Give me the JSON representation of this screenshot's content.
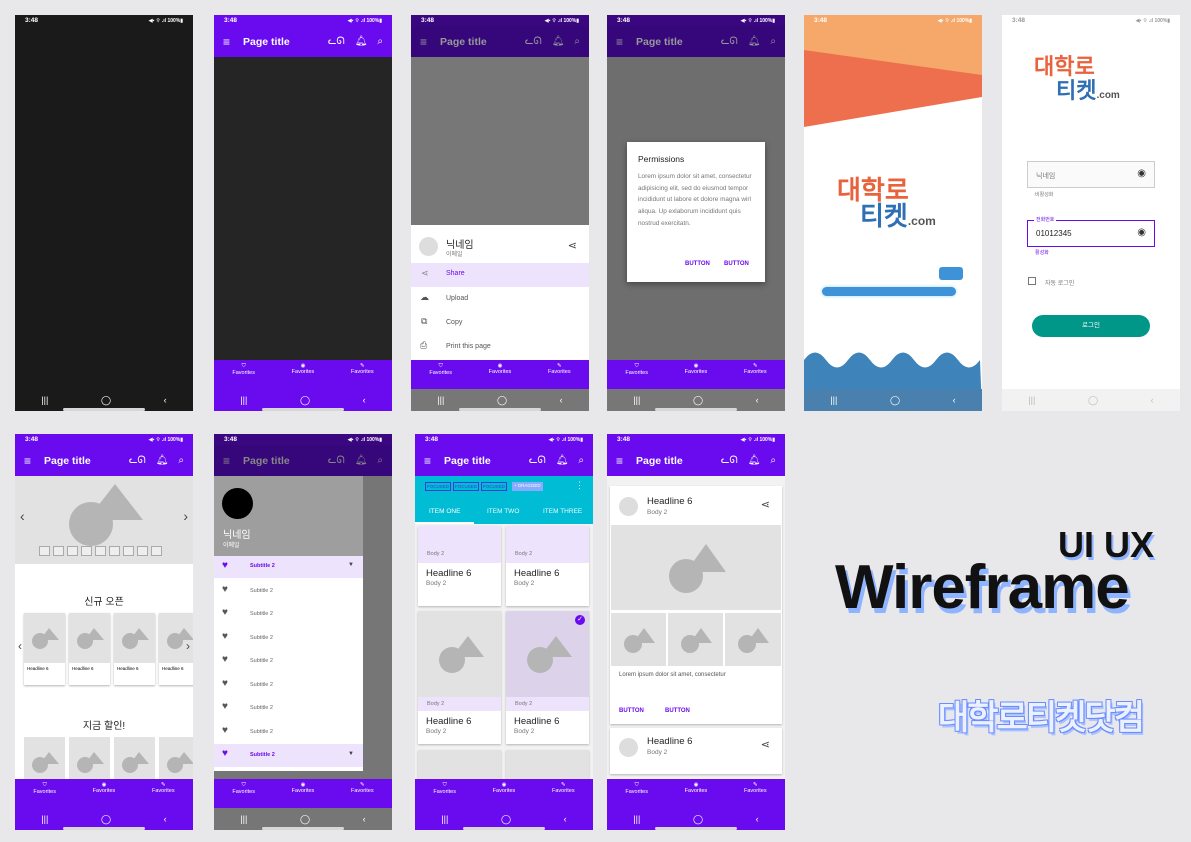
{
  "status": {
    "time": "3:48",
    "icons": "◀▪ ⌔ .ıl 100%▮"
  },
  "appbar": {
    "title": "Page title"
  },
  "bottom_nav": [
    "Favorites",
    "Favorites",
    "Favorites"
  ],
  "sheet": {
    "name": "닉네임",
    "sub": "이메일",
    "items": [
      "Share",
      "Upload",
      "Copy",
      "Print this page"
    ]
  },
  "dialog": {
    "title": "Permissions",
    "body": "Lorem ipsum dolor sit amet, consectetur adipisicing elit, sed do eiusmod tempor incididunt ut labore et dolore magna wirl aliqua. Up exlaborum incididunt quis nostrud exercitatn.",
    "btn1": "BUTTON",
    "btn2": "BUTTON"
  },
  "splash": {
    "logo_line1": "대학로",
    "logo_line2": "티켓",
    "logo_suffix": ".com"
  },
  "login": {
    "field1_value": "닉네임",
    "field1_helper": "비활성화",
    "field2_label": "전화번호",
    "field2_value": "01012345",
    "field2_helper": "활성화",
    "auto_login": "자동 로그인",
    "login_btn": "로그인"
  },
  "main": {
    "section1": "신규 오픈",
    "section2": "지금 할인!",
    "card_title": "Headline 6",
    "card_body": "Body 2"
  },
  "drawer": {
    "name": "닉네임",
    "sub": "이메일",
    "item": "Subtitle 2"
  },
  "grid": {
    "chips": [
      "FOCUSED",
      "FOCUSED",
      "FOCUSED"
    ],
    "drag_chip": "+ DRAGGED",
    "tabs": [
      "ITEM ONE",
      "ITEM TWO",
      "ITEM THREE"
    ],
    "headline": "Headline 6",
    "body": "Body 2"
  },
  "detail": {
    "headline": "Headline 6",
    "body": "Body 2",
    "lorem": "Lorem ipsum dolor sit amet, consectetur",
    "btn1": "BUTTON",
    "btn2": "BUTTON"
  },
  "banner": {
    "line1": "UI UX",
    "line2": "Wireframe",
    "line3": "대학로티켓닷컴"
  },
  "colors": {
    "primary": "#6a0bef",
    "teal": "#009688",
    "cyan": "#00bcd4"
  }
}
